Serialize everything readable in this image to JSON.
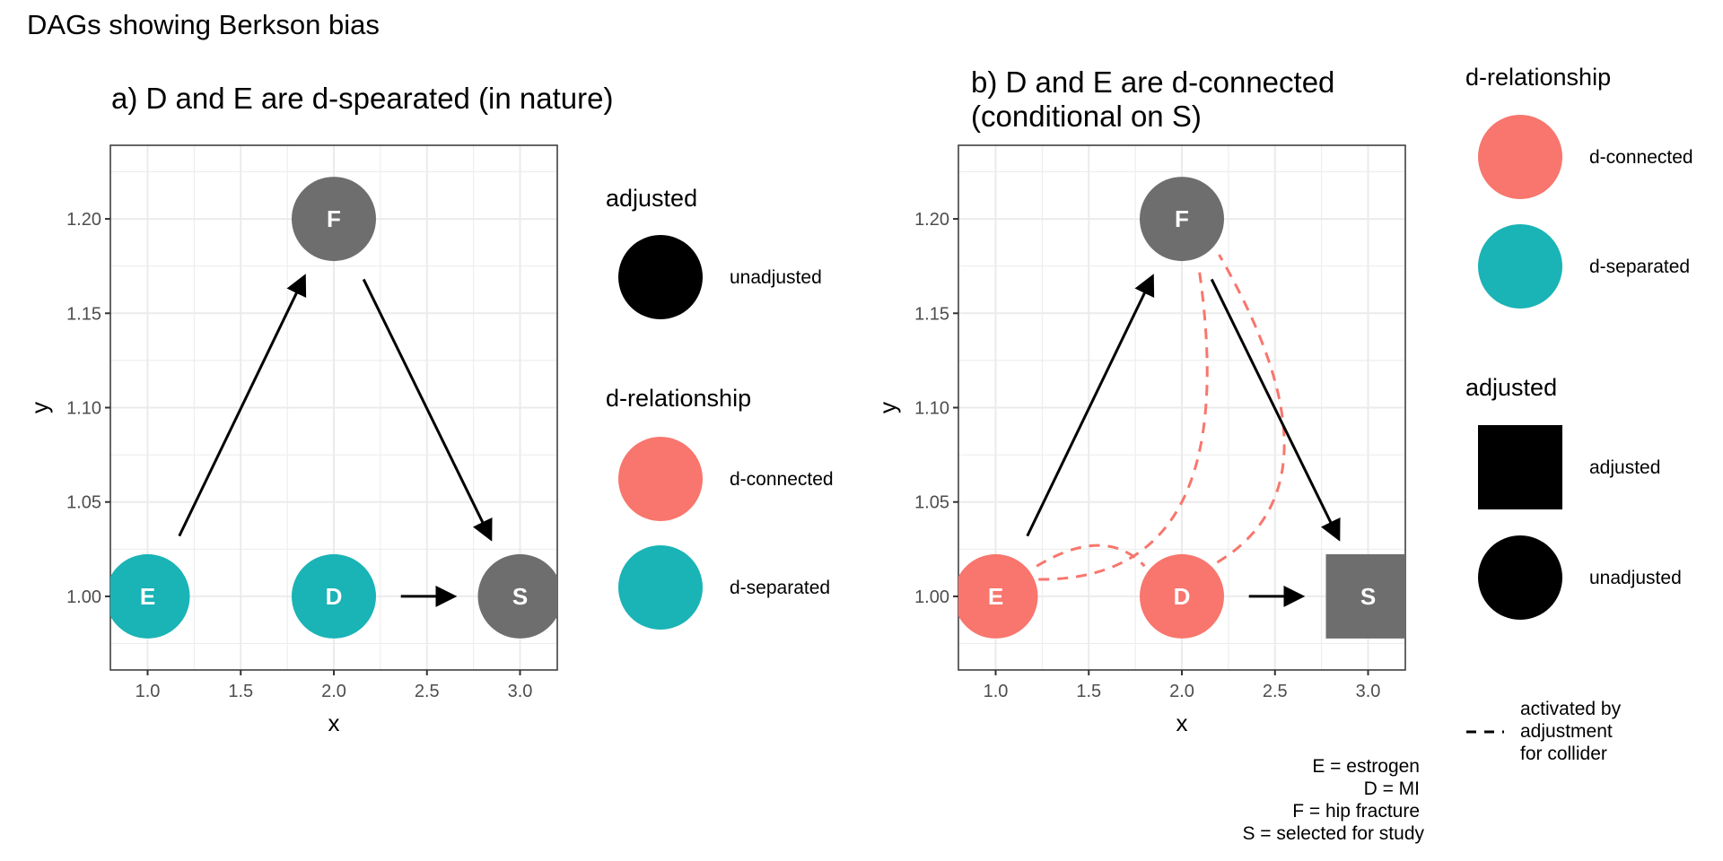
{
  "figure_title": "DAGs showing Berkson bias",
  "colors": {
    "d_connected": "#F8766D",
    "d_separated": "#1AB3B6",
    "node_default": "#6E6E6E",
    "edge": "#000000",
    "grid": "#EBEBEB",
    "panel_border": "#333333"
  },
  "chart_data": [
    {
      "type": "scatter",
      "panel": "a",
      "title": "a) D and E are d-spearated (in nature)",
      "xlabel": "x",
      "ylabel": "y",
      "xlim": [
        0.8,
        3.2
      ],
      "ylim": [
        0.961,
        1.239
      ],
      "x_ticks": [
        "1.0",
        "1.5",
        "2.0",
        "2.5",
        "3.0"
      ],
      "x_tick_values": [
        1.0,
        1.5,
        2.0,
        2.5,
        3.0
      ],
      "y_ticks": [
        "1.00",
        "1.05",
        "1.10",
        "1.15",
        "1.20"
      ],
      "y_tick_values": [
        1.0,
        1.05,
        1.1,
        1.15,
        1.2
      ],
      "grid": true,
      "nodes": [
        {
          "name": "E",
          "x": 1.0,
          "y": 1.0,
          "status": "d-separated",
          "adjusted": "unadjusted"
        },
        {
          "name": "D",
          "x": 2.0,
          "y": 1.0,
          "status": "d-separated",
          "adjusted": "unadjusted"
        },
        {
          "name": "F",
          "x": 2.0,
          "y": 1.2,
          "status": "none",
          "adjusted": "unadjusted"
        },
        {
          "name": "S",
          "x": 3.0,
          "y": 1.0,
          "status": "none",
          "adjusted": "unadjusted"
        }
      ],
      "edges": [
        {
          "from": "E",
          "to": "F",
          "x0": 1.17,
          "y0": 1.032,
          "x1": 1.84,
          "y1": 1.169
        },
        {
          "from": "F",
          "to": "S",
          "x0": 2.16,
          "y0": 1.168,
          "x1": 2.84,
          "y1": 1.031
        },
        {
          "from": "D",
          "to": "S",
          "x0": 2.36,
          "y0": 1.0,
          "x1": 2.64,
          "y1": 1.0
        }
      ],
      "dashed_paths": [],
      "legend": [
        {
          "title": "adjusted",
          "items": [
            {
              "label": "unadjusted",
              "shape": "circle",
              "color": "#000000"
            }
          ]
        },
        {
          "title": "d-relationship",
          "items": [
            {
              "label": "d-connected",
              "shape": "circle",
              "color": "#F8766D"
            },
            {
              "label": "d-separated",
              "shape": "circle",
              "color": "#1AB3B6"
            }
          ]
        }
      ],
      "legend_position": "right"
    },
    {
      "type": "scatter",
      "panel": "b",
      "title_lines": [
        "b) D and E are d-connected",
        "(conditional on S)"
      ],
      "xlabel": "x",
      "ylabel": "y",
      "xlim": [
        0.8,
        3.2
      ],
      "ylim": [
        0.961,
        1.239
      ],
      "x_ticks": [
        "1.0",
        "1.5",
        "2.0",
        "2.5",
        "3.0"
      ],
      "x_tick_values": [
        1.0,
        1.5,
        2.0,
        2.5,
        3.0
      ],
      "y_ticks": [
        "1.00",
        "1.05",
        "1.10",
        "1.15",
        "1.20"
      ],
      "y_tick_values": [
        1.0,
        1.05,
        1.1,
        1.15,
        1.2
      ],
      "grid": true,
      "nodes": [
        {
          "name": "E",
          "x": 1.0,
          "y": 1.0,
          "status": "d-connected",
          "adjusted": "unadjusted"
        },
        {
          "name": "D",
          "x": 2.0,
          "y": 1.0,
          "status": "d-connected",
          "adjusted": "unadjusted"
        },
        {
          "name": "F",
          "x": 2.0,
          "y": 1.2,
          "status": "none",
          "adjusted": "unadjusted"
        },
        {
          "name": "S",
          "x": 3.0,
          "y": 1.0,
          "status": "none",
          "adjusted": "adjusted"
        }
      ],
      "edges": [
        {
          "from": "E",
          "to": "F",
          "x0": 1.17,
          "y0": 1.032,
          "x1": 1.84,
          "y1": 1.169
        },
        {
          "from": "F",
          "to": "S",
          "x0": 2.16,
          "y0": 1.168,
          "x1": 2.84,
          "y1": 1.031
        },
        {
          "from": "D",
          "to": "S",
          "x0": 2.36,
          "y0": 1.0,
          "x1": 2.64,
          "y1": 1.0
        }
      ],
      "dashed_paths": [
        {
          "from": "E",
          "to": "D",
          "points": [
            [
              1.22,
              1.016
            ],
            [
              1.55,
              1.027
            ],
            [
              1.8,
              1.016
            ]
          ]
        },
        {
          "from": "E",
          "to": "F",
          "points": [
            [
              1.23,
              1.009
            ],
            [
              2.0,
              1.05
            ],
            [
              2.09,
              1.175
            ]
          ]
        },
        {
          "from": "D",
          "to": "F",
          "points": [
            [
              2.19,
              1.018
            ],
            [
              2.55,
              1.08
            ],
            [
              2.2,
              1.181
            ]
          ]
        }
      ],
      "legend": [
        {
          "title": "d-relationship",
          "items": [
            {
              "label": "d-connected",
              "shape": "circle",
              "color": "#F8766D"
            },
            {
              "label": "d-separated",
              "shape": "circle",
              "color": "#1AB3B6"
            }
          ]
        },
        {
          "title": "adjusted",
          "items": [
            {
              "label": "adjusted",
              "shape": "square",
              "color": "#000000"
            },
            {
              "label": "unadjusted",
              "shape": "circle",
              "color": "#000000"
            }
          ]
        },
        {
          "title": "",
          "items": [
            {
              "label_lines": [
                "activated by",
                "adjustment",
                "for collider"
              ],
              "shape": "dashed-line",
              "color": "#000000"
            }
          ]
        }
      ],
      "legend_position": "right",
      "caption_lines": [
        "E = estrogen",
        "D = MI",
        "F = hip fracture",
        "S = selected for study"
      ]
    }
  ]
}
